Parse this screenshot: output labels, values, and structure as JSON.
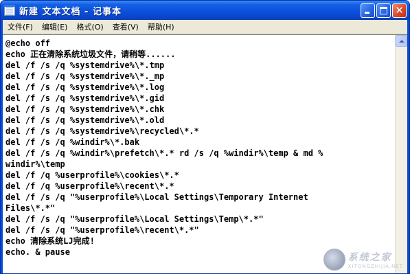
{
  "window": {
    "title": "新建 文本文档 - 记事本"
  },
  "menu": [
    {
      "id": "file",
      "label": "文件(F)"
    },
    {
      "id": "edit",
      "label": "编辑(E)"
    },
    {
      "id": "format",
      "label": "格式(O)"
    },
    {
      "id": "view",
      "label": "查看(V)"
    },
    {
      "id": "help",
      "label": "帮助(H)"
    }
  ],
  "editor": {
    "lines": [
      "@echo off",
      "echo 正在清除系统垃圾文件，请稍等......",
      "del /f /s /q %systemdrive%\\*.tmp",
      "del /f /s /q %systemdrive%\\*._mp",
      "del /f /s /q %systemdrive%\\*.log",
      "del /f /s /q %systemdrive%\\*.gid",
      "del /f /s /q %systemdrive%\\*.chk",
      "del /f /s /q %systemdrive%\\*.old",
      "del /f /s /q %systemdrive%\\recycled\\*.*",
      "del /f /s /q %windir%\\*.bak",
      "del /f /s /q %windir%\\prefetch\\*.* rd /s /q %windir%\\temp & md %",
      "windir%\\temp",
      "del /f /q %userprofile%\\cookies\\*.*",
      "del /f /q %userprofile%\\recent\\*.*",
      "del /f /s /q \"%userprofile%\\Local Settings\\Temporary Internet",
      "Files\\*.*\"",
      "del /f /s /q \"%userprofile%\\Local Settings\\Temp\\*.*\"",
      "del /f /s /q \"%userprofile%\\recent\\*.*\"",
      "echo 清除系统LJ完成!",
      "echo. & pause"
    ]
  },
  "watermark": {
    "main": "系统之家",
    "sub": "XITONGZHIJIA.NET"
  },
  "colors": {
    "titlebar": "#0c50db",
    "menubar": "#ece9d8",
    "close_button": "#d8472a"
  }
}
